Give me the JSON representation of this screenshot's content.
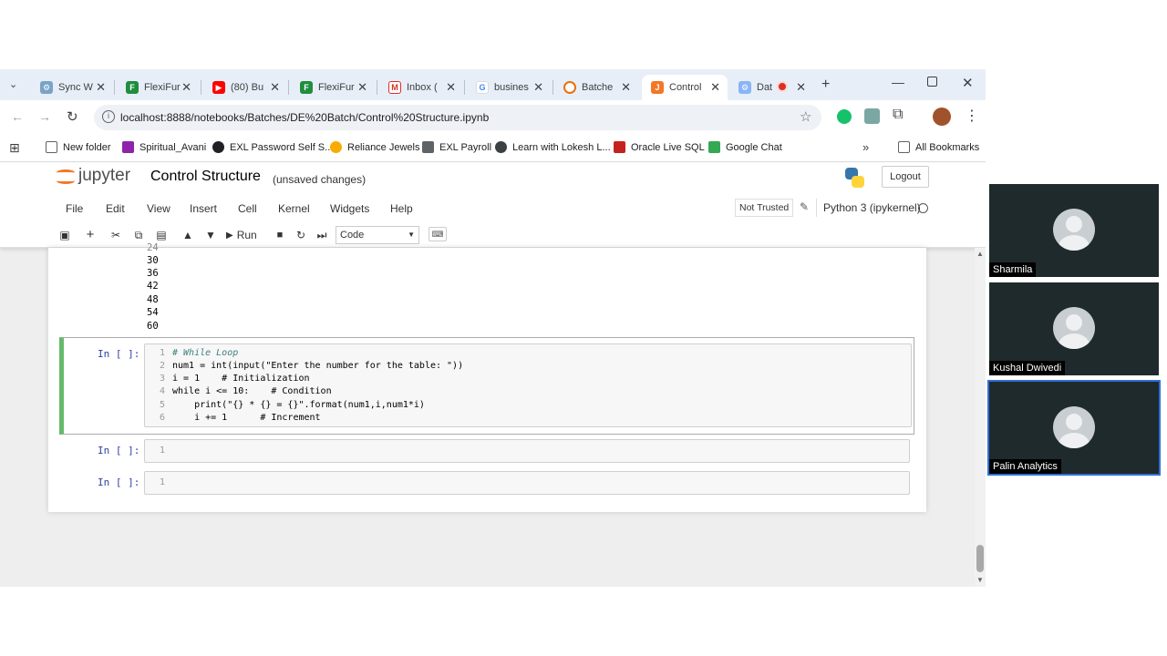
{
  "browser": {
    "tabs": [
      {
        "title": "Sync W",
        "icon": "sync-icon"
      },
      {
        "title": "FlexiFur",
        "icon": "flexi-icon"
      },
      {
        "title": "(80) Bu",
        "icon": "youtube-icon"
      },
      {
        "title": "FlexiFur",
        "icon": "flexi-icon"
      },
      {
        "title": "Inbox (",
        "icon": "gmail-icon"
      },
      {
        "title": "busines",
        "icon": "google-icon"
      },
      {
        "title": "Batche",
        "icon": "batch-icon"
      },
      {
        "title": "Control",
        "icon": "jupyter-icon"
      },
      {
        "title": "Dat",
        "icon": "data-icon"
      }
    ],
    "url": "localhost:8888/notebooks/Batches/DE%20Batch/Control%20Structure.ipynb",
    "bookmarks": [
      "New folder",
      "Spiritual_Avani",
      "EXL Password Self S...",
      "Reliance Jewels",
      "EXL Payroll",
      "Learn with Lokesh L...",
      "Oracle Live SQL",
      "Google Chat"
    ],
    "all_bookmarks": "All Bookmarks"
  },
  "jupyter": {
    "logo_text": "jupyter",
    "notebook_title": "Control Structure",
    "save_status": "(unsaved changes)",
    "logout": "Logout",
    "menu": [
      "File",
      "Edit",
      "View",
      "Insert",
      "Cell",
      "Kernel",
      "Widgets",
      "Help"
    ],
    "trust_status": "Not Trusted",
    "kernel": "Python 3 (ipykernel)",
    "run_label": "Run",
    "cell_type": "Code"
  },
  "output_values": [
    "30",
    "36",
    "42",
    "48",
    "54",
    "60"
  ],
  "cells": [
    {
      "prompt": "In [ ]:",
      "lines": [
        {
          "n": "1",
          "code": "# While Loop"
        },
        {
          "n": "2",
          "code": "num1 = int(input(\"Enter the number for the table: \"))"
        },
        {
          "n": "3",
          "code": "i = 1    # Initialization"
        },
        {
          "n": "4",
          "code": "while i <= 10:    # Condition"
        },
        {
          "n": "5",
          "code": "    print(\"{} * {} = {}\".format(num1,i,num1*i)"
        },
        {
          "n": "6",
          "code": "    i += 1      # Increment"
        }
      ]
    },
    {
      "prompt": "In [ ]:",
      "lines": [
        {
          "n": "1",
          "code": ""
        }
      ]
    },
    {
      "prompt": "In [ ]:",
      "lines": [
        {
          "n": "1",
          "code": ""
        }
      ]
    }
  ],
  "participants": [
    {
      "name": "Sharmila"
    },
    {
      "name": "Kushal Dwivedi"
    },
    {
      "name": "Palin Analytics"
    }
  ],
  "colors": {
    "active_cell_border": "#66bb6a",
    "active_tile_border": "#2f6fd6",
    "tile_bg": "#1f2a2c"
  }
}
